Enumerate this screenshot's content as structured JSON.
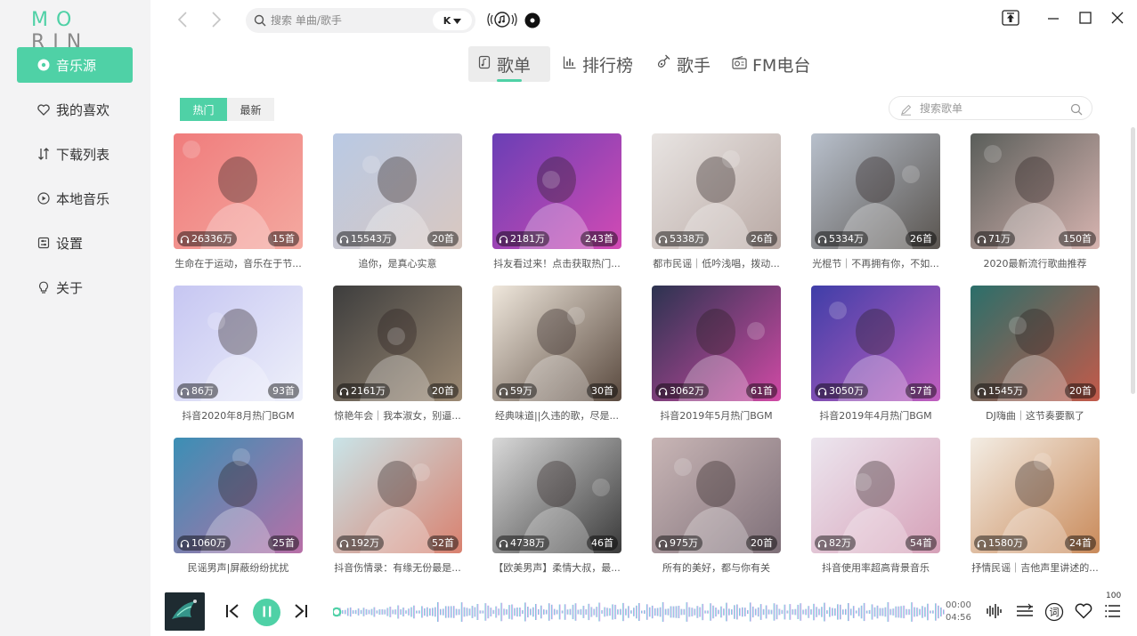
{
  "app": {
    "logo_part1": "MO",
    "logo_part2": "RIN"
  },
  "sidebar": {
    "items": [
      {
        "label": "音乐源",
        "icon": "disc-icon",
        "active": true
      },
      {
        "label": "我的喜欢",
        "icon": "heart-icon",
        "active": false
      },
      {
        "label": "下载列表",
        "icon": "download-sort-icon",
        "active": false
      },
      {
        "label": "本地音乐",
        "icon": "play-circle-icon",
        "active": false
      },
      {
        "label": "设置",
        "icon": "settings-icon",
        "active": false
      },
      {
        "label": "关于",
        "icon": "lightbulb-icon",
        "active": false
      }
    ]
  },
  "topbar": {
    "search_placeholder": "搜索 单曲/歌手",
    "source_label": "K",
    "window_icons": [
      "pin-top-icon",
      "minimize-icon",
      "maximize-icon",
      "close-icon"
    ]
  },
  "tabs": [
    {
      "label": "歌单",
      "icon": "playlist-icon",
      "active": true
    },
    {
      "label": "排行榜",
      "icon": "bar-chart-icon",
      "active": false
    },
    {
      "label": "歌手",
      "icon": "guitar-icon",
      "active": false
    },
    {
      "label": "FM电台",
      "icon": "radio-icon",
      "active": false
    }
  ],
  "filter": {
    "hot": "热门",
    "new": "最新",
    "active": "hot"
  },
  "playlist_search": {
    "placeholder": "搜索歌单"
  },
  "playlists": [
    {
      "plays": "26336万",
      "count": "15首",
      "title": "生命在于运动，音乐在于节...",
      "colors": [
        "#f07c7c",
        "#f4a9a0"
      ]
    },
    {
      "plays": "15543万",
      "count": "20首",
      "title": "追你，是真心实意",
      "colors": [
        "#b9c9e4",
        "#d9c8c0"
      ]
    },
    {
      "plays": "2181万",
      "count": "243首",
      "title": "抖友看过来！点击获取热门...",
      "colors": [
        "#6a3fb5",
        "#d24ab4"
      ]
    },
    {
      "plays": "5338万",
      "count": "26首",
      "title": "都市民谣｜低吟浅唱，拨动...",
      "colors": [
        "#e8e4e2",
        "#b9a9a4"
      ]
    },
    {
      "plays": "5334万",
      "count": "26首",
      "title": "光棍节｜不再拥有你，不如...",
      "colors": [
        "#b8c0cc",
        "#5a5550"
      ]
    },
    {
      "plays": "71万",
      "count": "150首",
      "title": "2020最新流行歌曲推荐",
      "colors": [
        "#5a5e5a",
        "#d7b4b0"
      ]
    },
    {
      "plays": "86万",
      "count": "93首",
      "title": "抖音2020年8月热门BGM",
      "colors": [
        "#c6c6f2",
        "#eef0fa"
      ]
    },
    {
      "plays": "2161万",
      "count": "20首",
      "title": "惊艳年会｜我本淑女，别逼...",
      "colors": [
        "#3d3d3d",
        "#9c8a74"
      ]
    },
    {
      "plays": "59万",
      "count": "30首",
      "title": "经典味道||久违的歌，尽是...",
      "colors": [
        "#efe7dc",
        "#5a4a3f"
      ]
    },
    {
      "plays": "3062万",
      "count": "61首",
      "title": "抖音2019年5月热门BGM",
      "colors": [
        "#2c3350",
        "#d04aa5"
      ]
    },
    {
      "plays": "3050万",
      "count": "57首",
      "title": "抖音2019年4月热门BGM",
      "colors": [
        "#3f3ea8",
        "#c15fbf"
      ]
    },
    {
      "plays": "1545万",
      "count": "20首",
      "title": "DJ嗨曲｜这节奏要飘了",
      "colors": [
        "#2b6f6a",
        "#c35a4a"
      ]
    },
    {
      "plays": "1060万",
      "count": "25首",
      "title": "民谣男声|屏蔽纷纷扰扰",
      "colors": [
        "#3b8fb5",
        "#b86fa7"
      ]
    },
    {
      "plays": "192万",
      "count": "52首",
      "title": "抖音伤情录：有缘无份最是...",
      "colors": [
        "#c9e4e8",
        "#d9816f"
      ]
    },
    {
      "plays": "4738万",
      "count": "46首",
      "title": "【欧美男声】柔情大叔，最...",
      "colors": [
        "#d9d9d9",
        "#3a3a3a"
      ]
    },
    {
      "plays": "975万",
      "count": "20首",
      "title": "所有的美好，都与你有关",
      "colors": [
        "#c9b6b6",
        "#7e6f78"
      ]
    },
    {
      "plays": "82万",
      "count": "54首",
      "title": "抖音使用率超高背景音乐",
      "colors": [
        "#ece6ef",
        "#d6a1b8"
      ]
    },
    {
      "plays": "1580万",
      "count": "24首",
      "title": "抒情民谣｜吉他声里讲述的...",
      "colors": [
        "#f3ede4",
        "#c98a5a"
      ]
    }
  ],
  "player": {
    "time_current": "00:00",
    "time_total": "04:56",
    "volume": "100",
    "progress": 0.0,
    "lyrics_label": "词"
  },
  "colors": {
    "accent": "#4fd1a6"
  }
}
